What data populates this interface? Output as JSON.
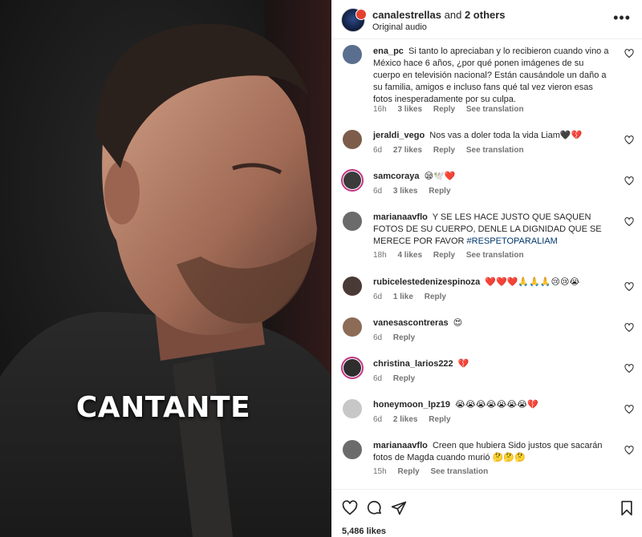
{
  "video": {
    "caption": "CANTANTE"
  },
  "header": {
    "author": "canalestrellas",
    "joiner": "and",
    "others": "2 others",
    "subtitle": "Original audio",
    "more_icon": "more-horizontal-icon"
  },
  "comments": [
    {
      "user": "ena_pc",
      "text": "Si tanto lo apreciaban y lo recibieron cuando vino a México hace 6 años, ¿por qué ponen imágenes de su cuerpo en televisión nacional? Están causándole un daño a su familia, amigos e incluso fans qué tal vez vieron esas fotos inesperadamente por su culpa.",
      "time": "16h",
      "likes": "3 likes",
      "reply": "Reply",
      "translation": "See translation",
      "avatar_color": "#5a6f8f"
    },
    {
      "user": "jeraldi_vego",
      "text": "Nos vas a doler toda la vida Liam🖤💔",
      "time": "6d",
      "likes": "27 likes",
      "reply": "Reply",
      "translation": "See translation",
      "avatar_color": "#7d5c4a"
    },
    {
      "user": "samcoraya",
      "text": "😪🕊️❤️",
      "time": "6d",
      "likes": "3 likes",
      "reply": "Reply",
      "avatar_color": "#3b3b3b"
    },
    {
      "user": "marianaavflo",
      "text": "Y SE LES HACE JUSTO QUE SAQUEN FOTOS DE SU CUERPO, DENLE LA DIGNIDAD QUE SE MERECE POR FAVOR ",
      "hashtag": "#RESPETOPARALIAM",
      "time": "18h",
      "likes": "4 likes",
      "reply": "Reply",
      "translation": "See translation",
      "avatar_color": "#6b6b6b"
    },
    {
      "user": "rubicelestedenizespinoza",
      "text": "❤️❤️❤️🙏🙏🙏😢😢😭",
      "time": "6d",
      "likes": "1 like",
      "reply": "Reply",
      "avatar_color": "#4a3a36"
    },
    {
      "user": "vanesascontreras",
      "text": "😍",
      "time": "6d",
      "reply": "Reply",
      "avatar_color": "#8c6b57"
    },
    {
      "user": "christina_larios222",
      "text": "💔",
      "time": "6d",
      "reply": "Reply",
      "avatar_color": "#2e2e2e"
    },
    {
      "user": "honeymoon_lpz19",
      "text": "😭😭😭😭😭😭😭💔",
      "time": "6d",
      "likes": "2 likes",
      "reply": "Reply",
      "avatar_color": "#c7c7c7"
    },
    {
      "user": "marianaavflo",
      "text": "Creen que hubiera Sido justos que sacarán fotos de Magda cuando murió 🤔🤔🤔",
      "time": "15h",
      "reply": "Reply",
      "translation": "See translation",
      "avatar_color": "#6b6b6b"
    }
  ],
  "footer": {
    "likes": "5,486 likes",
    "icons": [
      "heart-icon",
      "comment-icon",
      "share-icon",
      "bookmark-icon"
    ]
  },
  "colors": {
    "text": "#262626",
    "muted": "#737373",
    "hashtag": "#00376b",
    "story_ring": "#c13584"
  }
}
